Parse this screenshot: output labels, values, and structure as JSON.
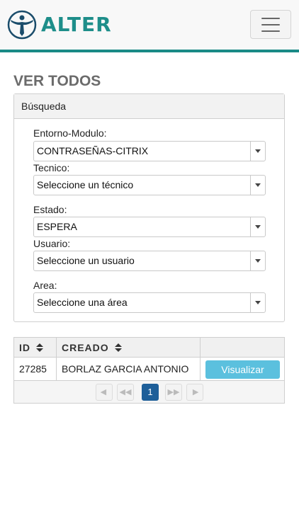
{
  "brand": {
    "name": "ALTER",
    "accent": "#1a8a86",
    "logo_icon": "vitruvian-man-icon"
  },
  "nav": {
    "menu_icon": "hamburger-menu-icon"
  },
  "page": {
    "title": "VER TODOS"
  },
  "search_panel": {
    "heading": "Búsqueda",
    "fields": [
      {
        "label": "Entorno-Modulo:",
        "value": "CONTRASEÑAS-CITRIX"
      },
      {
        "label": "Tecnico:",
        "value": "Seleccione un técnico"
      },
      {
        "label": "Estado:",
        "value": "ESPERA"
      },
      {
        "label": "Usuario:",
        "value": "Seleccione un usuario"
      },
      {
        "label": "Area:",
        "value": "Seleccione una área"
      }
    ]
  },
  "table": {
    "columns": [
      "ID",
      "CREADO"
    ],
    "rows": [
      {
        "id": "27285",
        "creado": "BORLAZ GARCIA ANTONIO",
        "action": "Visualizar"
      }
    ],
    "action_color": "#5bc0de"
  },
  "pagination": {
    "first_icon": "first-page-icon",
    "prev_icon": "previous-page-icon",
    "current_page": "1",
    "next_icon": "next-page-icon",
    "last_icon": "last-page-icon",
    "active_color": "#1e5f99"
  }
}
